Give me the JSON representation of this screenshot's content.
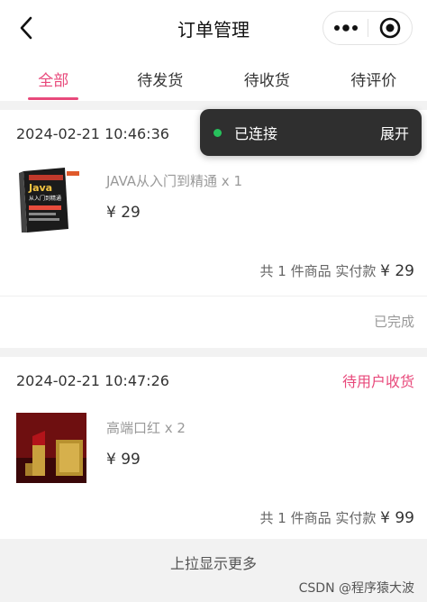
{
  "navbar": {
    "title": "订单管理",
    "back_icon": "chevron-left-icon",
    "more_icon": "more-dots-icon",
    "close_icon": "target-close-icon"
  },
  "tabs": [
    {
      "label": "全部",
      "active": true
    },
    {
      "label": "待发货",
      "active": false
    },
    {
      "label": "待收货",
      "active": false
    },
    {
      "label": "待评价",
      "active": false
    }
  ],
  "toast": {
    "text": "已连接",
    "expand_label": "展开",
    "dot_color": "#27c15c"
  },
  "orders": [
    {
      "time": "2024-02-21 10:46:36",
      "status": "",
      "item_name": "JAVA从入门到精通 x 1",
      "price": "¥ 29",
      "total_prefix": "共 1 件商品 实付款",
      "total_amount": "¥ 29",
      "footer_status": "已完成",
      "cover_title": "Java",
      "cover_subtitle": "从入门到精通"
    },
    {
      "time": "2024-02-21 10:47:26",
      "status": "待用户收货",
      "item_name": "高端口红 x 2",
      "price": "¥ 99",
      "total_prefix": "共 1 件商品 实付款",
      "total_amount": "¥ 99"
    }
  ],
  "load_more": "上拉显示更多",
  "watermark": "CSDN @程序猿大波",
  "colors": {
    "accent": "#e8497b",
    "background": "#f2f2f2"
  }
}
